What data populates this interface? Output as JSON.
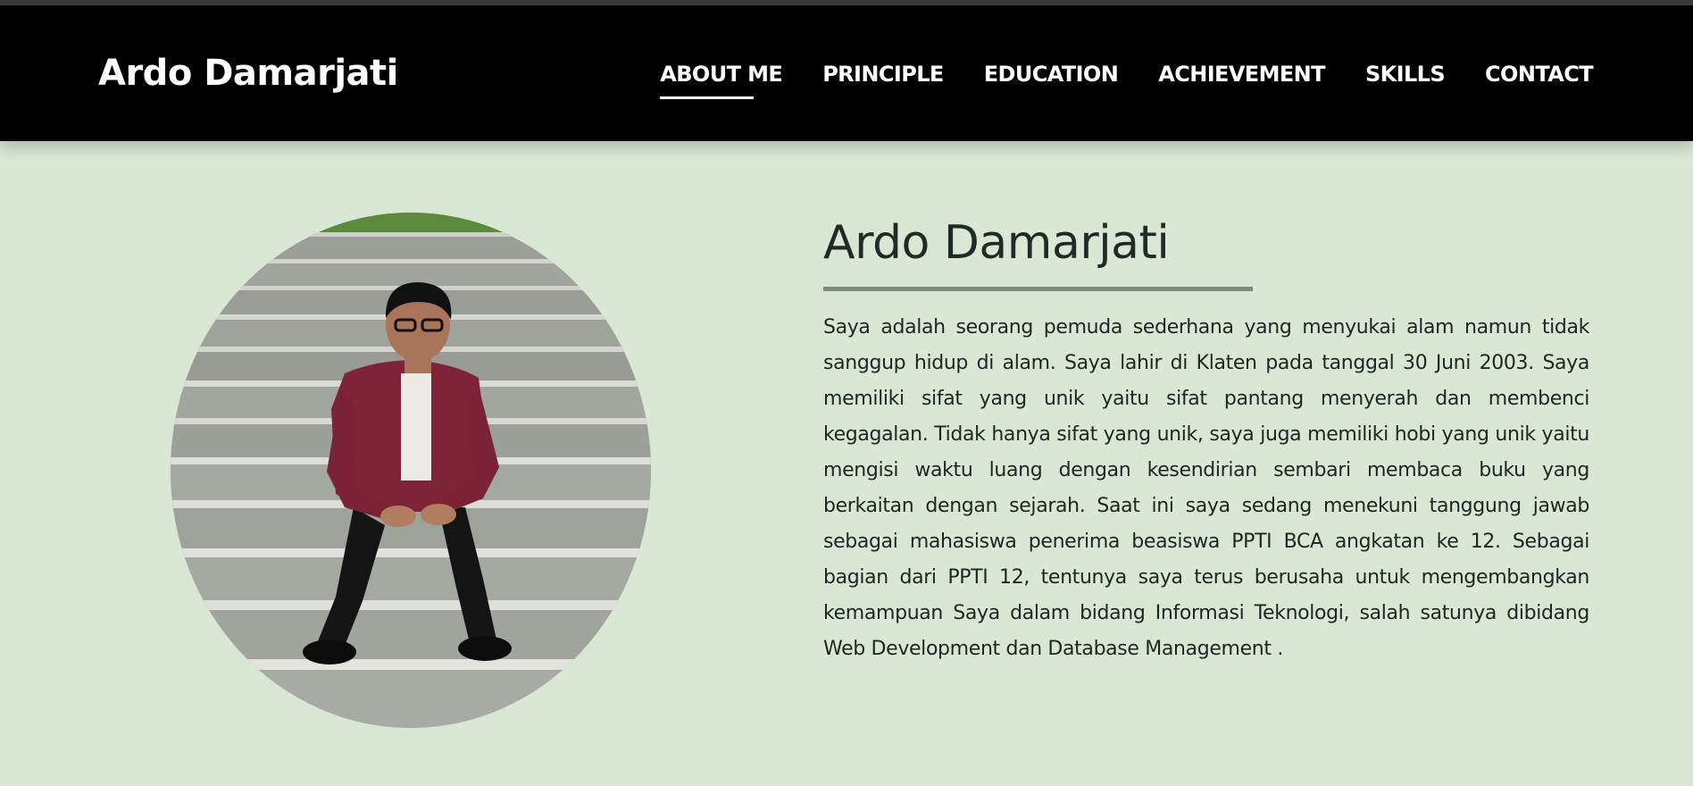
{
  "brand": "Ardo Damarjati",
  "nav": {
    "items": [
      {
        "label": "ABOUT ME",
        "active": true
      },
      {
        "label": "PRINCIPLE"
      },
      {
        "label": "EDUCATION"
      },
      {
        "label": "ACHIEVEMENT"
      },
      {
        "label": "SKILLS"
      },
      {
        "label": "CONTACT"
      }
    ]
  },
  "about": {
    "title": "Ardo Damarjati",
    "bio": "Saya adalah seorang pemuda sederhana yang menyukai alam namun tidak sanggup hidup di alam. Saya lahir di Klaten pada tanggal 30 Juni 2003. Saya memiliki sifat yang unik yaitu sifat pantang menyerah dan membenci kegagalan. Tidak hanya sifat yang unik, saya juga memiliki hobi yang unik yaitu mengisi waktu luang dengan kesendirian sembari membaca buku yang berkaitan dengan sejarah. Saat ini saya sedang menekuni tanggung jawab sebagai mahasiswa penerima beasiswa PPTI BCA angkatan ke 12. Sebagai bagian dari PPTI 12, tentunya saya terus berusaha untuk mengembangkan kemampuan Saya dalam bidang Informasi Teknologi, salah satunya dibidang Web Development dan Database Management ."
  },
  "colors": {
    "page_background": "#d8e8d4",
    "navbar_background": "#000000",
    "divider": "#7e8b7c",
    "text": "#1f2522"
  }
}
